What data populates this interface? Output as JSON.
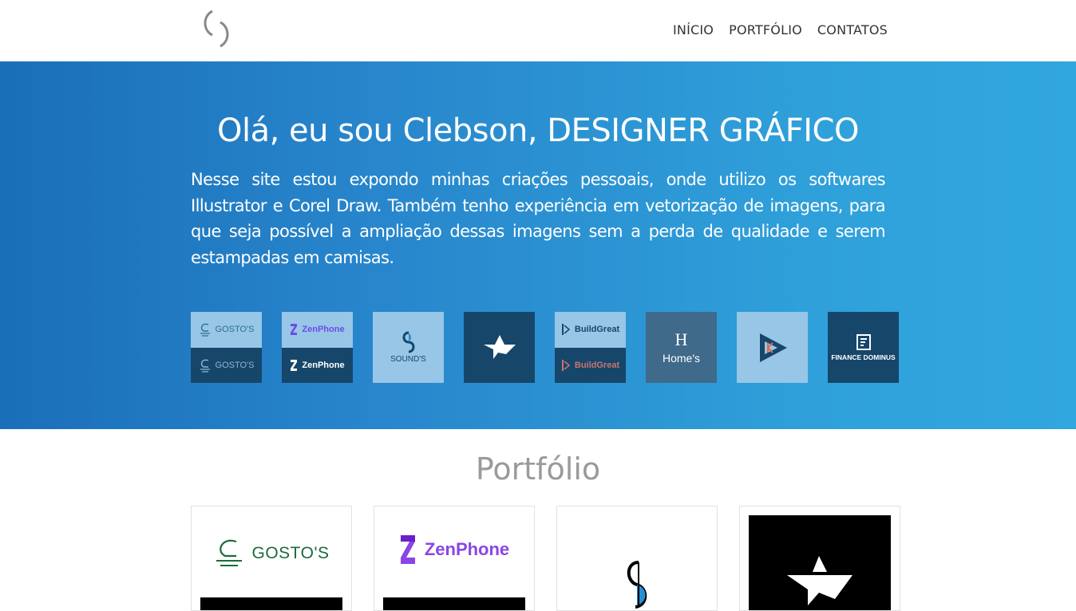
{
  "nav": {
    "items": [
      "INÍCIO",
      "PORTFÓLIO",
      "CONTATOS"
    ]
  },
  "hero": {
    "title": "Olá, eu sou Clebson, DESIGNER GRÁFICO",
    "description": "Nesse site estou expondo minhas criações pessoais, onde utilizo os softwares Illustrator e Corel Draw. Também tenho experiência em vetorização de imagens, para que seja possível a ampliação dessas imagens sem a perda de qualidade e serem estampadas em camisas."
  },
  "thumbnails": [
    {
      "top_label": "GOSTO'S",
      "bottom_label": "GOSTO'S"
    },
    {
      "top_label": "ZenPhone",
      "bottom_label": "ZenPhone"
    },
    {
      "label": "SOUND'S"
    },
    {
      "label": ""
    },
    {
      "top_label": "BuildGreat",
      "bottom_label": "BuildGreat"
    },
    {
      "label": "Home's"
    },
    {
      "label": ""
    },
    {
      "label": "FINANCE DOMINUS"
    }
  ],
  "portfolio": {
    "title": "Portfólio",
    "cards": [
      {
        "brand": "GOSTO'S"
      },
      {
        "brand": "ZenPhone"
      },
      {
        "brand": ""
      },
      {
        "brand": ""
      }
    ]
  },
  "colors": {
    "hero_start": "#1a6fb8",
    "hero_end": "#31a7df",
    "thumb_light": "#97c6e6",
    "thumb_dark": "#17466b",
    "zenphone_purple": "#8a45e6",
    "gostos_green": "#1b6b3c"
  }
}
